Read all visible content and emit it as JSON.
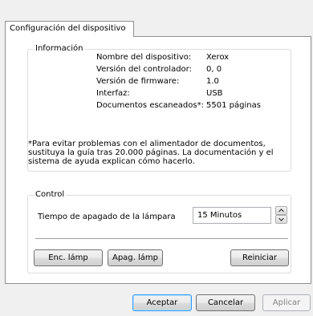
{
  "tabs": [
    {
      "label": "Configuración del dispositivo"
    }
  ],
  "info_group": {
    "label": "Información",
    "rows": [
      {
        "label": "Nombre del dispositivo:",
        "value": "Xerox"
      },
      {
        "label": "Versión del controlador:",
        "value": "0, 0"
      },
      {
        "label": "Versión de firmware:",
        "value": "1.0"
      },
      {
        "label": "Interfaz:",
        "value": "USB"
      },
      {
        "label": "Documentos escaneados*:",
        "value": "5501 páginas"
      }
    ],
    "note": "*Para evitar problemas con el alimentador de documentos, sustituya la guía tras 20.000 páginas. La documentación y el sistema de ayuda explican cómo hacerlo."
  },
  "control_group": {
    "label": "Control",
    "lamp_label": "Tiempo de apagado de la lámpara",
    "lamp_value": "15 Minutos",
    "lamp_on_button": "Enc. lámp",
    "lamp_off_button": "Apag. lámp",
    "reset_button": "Reiniciar"
  },
  "footer": {
    "accept": "Aceptar",
    "cancel": "Cancelar",
    "apply": "Aplicar"
  }
}
